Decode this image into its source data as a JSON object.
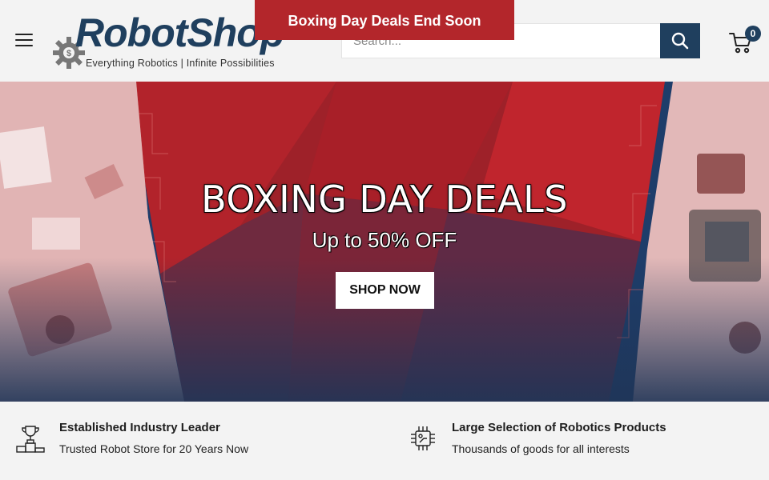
{
  "promo_bar": {
    "text": "Boxing Day Deals End Soon"
  },
  "header": {
    "logo_text": "RobotShop",
    "logo_tagline": "Everything Robotics | Infinite Possibilities",
    "search_placeholder": "Search...",
    "cart_count": "0"
  },
  "hero": {
    "title": "BOXING DAY DEALS",
    "subtitle": "Up to 50% OFF",
    "button_label": "SHOP NOW"
  },
  "features": [
    {
      "title": "Established Industry Leader",
      "desc": "Trusted Robot Store for 20 Years Now",
      "icon": "podium-trophy-icon"
    },
    {
      "title": "Large Selection of Robotics Products",
      "desc": "Thousands of goods for all interests",
      "icon": "chip-icon"
    }
  ],
  "colors": {
    "brand": "#1f3f5e",
    "promo_red": "#b3262b",
    "hero_red": "#a3222a"
  }
}
